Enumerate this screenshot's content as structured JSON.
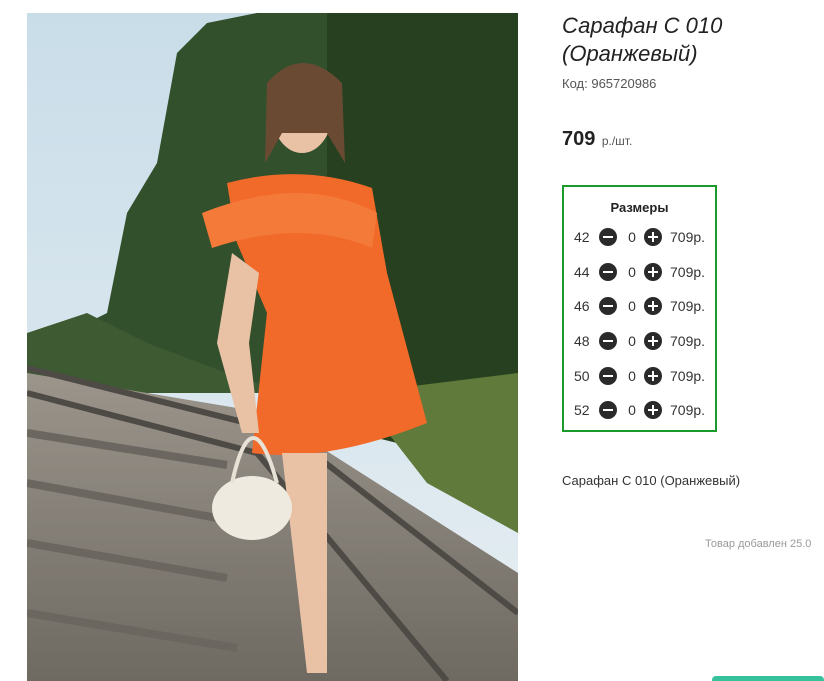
{
  "product": {
    "title": "Сарафан С 010 (Оранжевый)",
    "code_label": "Код:",
    "code": "965720986",
    "price": "709",
    "price_unit": "р./шт.",
    "description": "Сарафан С 010 (Оранжевый)",
    "added_text": "Товар добавлен 25.0"
  },
  "photo": {
    "alt": "product-photo",
    "colors": {
      "sky": "#cfe0ea",
      "forest": "#2f4a2a",
      "dress": "#f26a2a",
      "gravel": "#8a857e",
      "rail": "#5a5650"
    }
  },
  "sizes": {
    "title": "Размеры",
    "border_color": "#1a9a2a",
    "rows": [
      {
        "size": "42",
        "qty": "0",
        "price": "709р."
      },
      {
        "size": "44",
        "qty": "0",
        "price": "709р."
      },
      {
        "size": "46",
        "qty": "0",
        "price": "709р."
      },
      {
        "size": "48",
        "qty": "0",
        "price": "709р."
      },
      {
        "size": "50",
        "qty": "0",
        "price": "709р."
      },
      {
        "size": "52",
        "qty": "0",
        "price": "709р."
      }
    ]
  }
}
